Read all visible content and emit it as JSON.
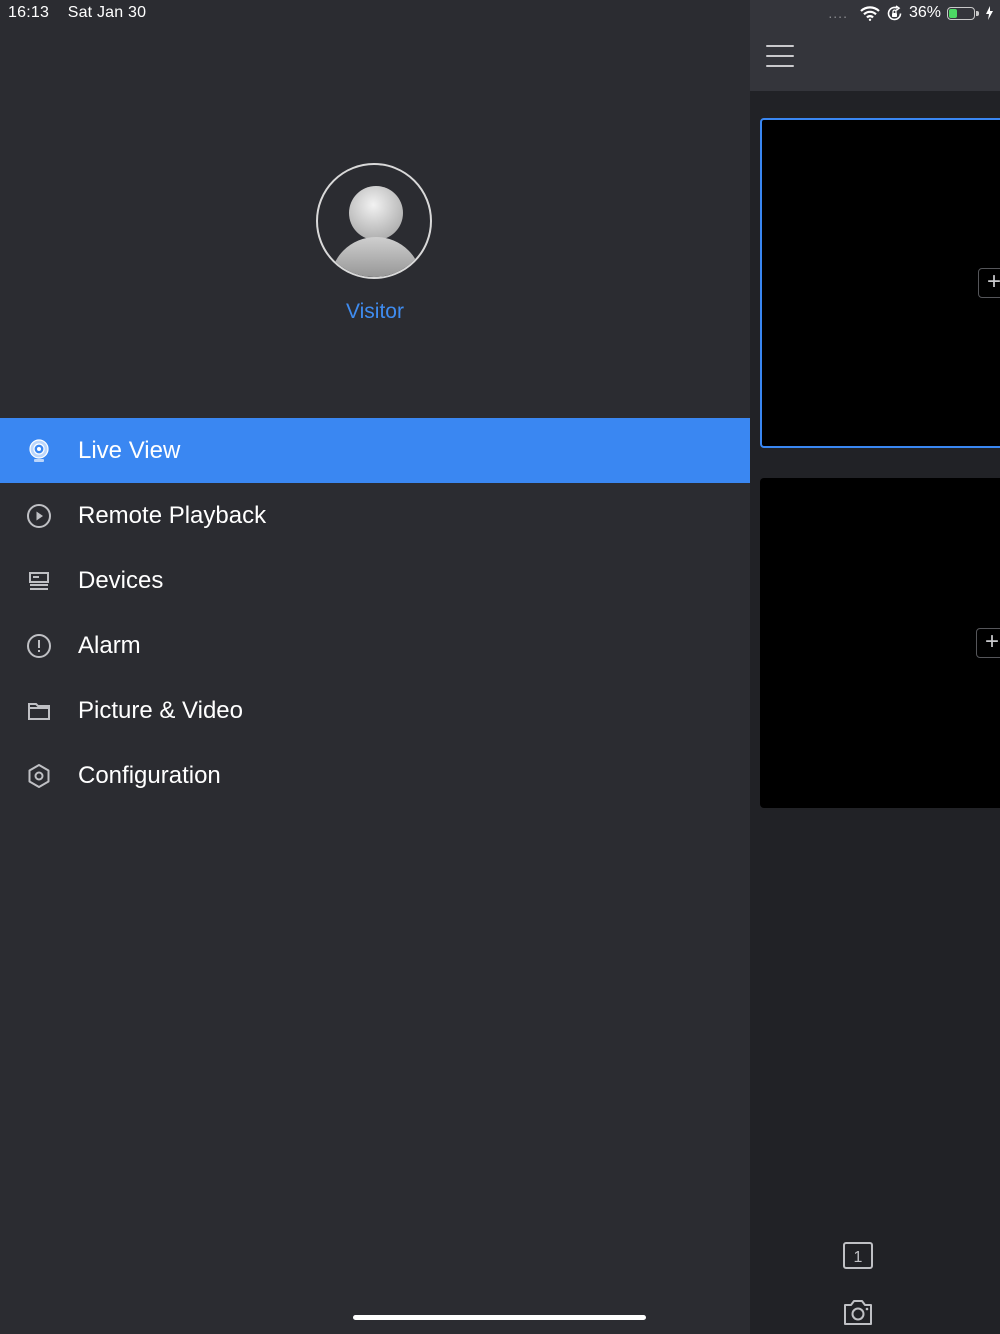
{
  "status_bar": {
    "time": "16:13",
    "date": "Sat Jan 30",
    "battery_percent": "36%",
    "battery_level": 0.36,
    "signal_indicator": "....",
    "icons": [
      "wifi-icon",
      "orientation-lock-icon",
      "battery-icon",
      "charging-bolt-icon"
    ]
  },
  "profile": {
    "username": "Visitor",
    "avatar_icon": "default-user-avatar"
  },
  "menu": {
    "items": [
      {
        "label": "Live View",
        "icon": "camera-icon",
        "active": true
      },
      {
        "label": "Remote Playback",
        "icon": "play-circle-icon",
        "active": false
      },
      {
        "label": "Devices",
        "icon": "device-list-icon",
        "active": false
      },
      {
        "label": "Alarm",
        "icon": "alarm-exclamation-icon",
        "active": false
      },
      {
        "label": "Picture & Video",
        "icon": "folder-icon",
        "active": false
      },
      {
        "label": "Configuration",
        "icon": "gear-icon",
        "active": false
      }
    ]
  },
  "live_view": {
    "menu_icon": "hamburger-icon",
    "tiles": [
      {
        "selected": true,
        "add_label": "+"
      },
      {
        "selected": false,
        "add_label": "+"
      }
    ],
    "window_count": "1",
    "snapshot_icon": "camera-snapshot-icon"
  },
  "colors": {
    "accent": "#3a87f2",
    "sidebar_bg": "#2b2c31",
    "pane_bg": "#212226",
    "username": "#3f8cf0"
  }
}
